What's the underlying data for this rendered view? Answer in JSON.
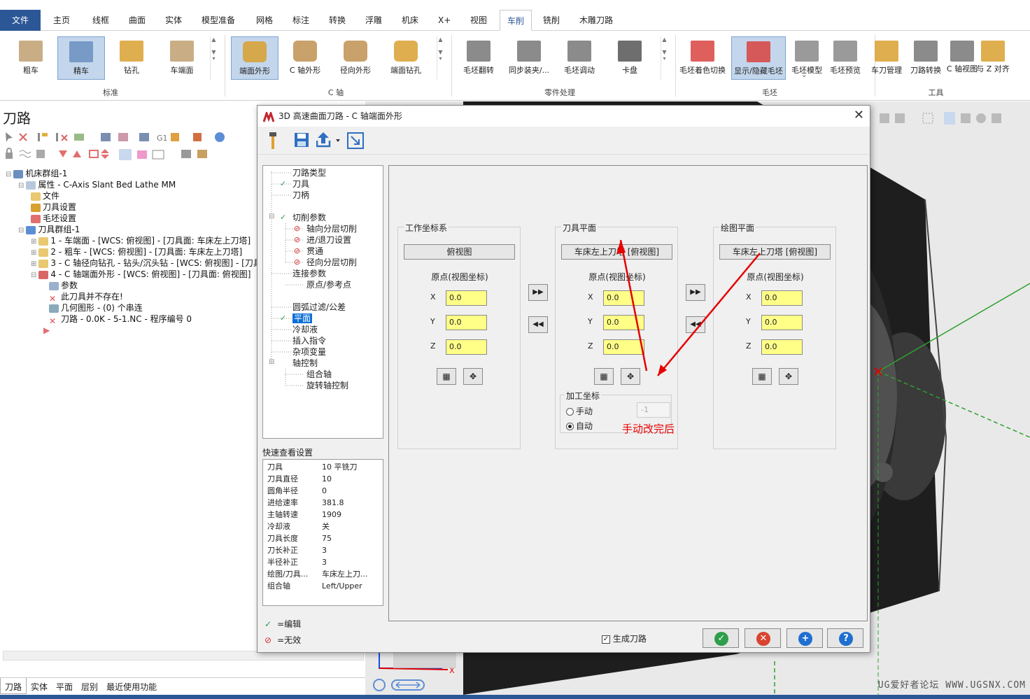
{
  "tabs": [
    "主页",
    "线框",
    "曲面",
    "实体",
    "模型准备",
    "网格",
    "标注",
    "转换",
    "浮雕",
    "机床",
    "X+",
    "视图",
    "车削",
    "铣削",
    "木雕刀路"
  ],
  "file_tab": "文件",
  "active_tab_index": 12,
  "ribbon": {
    "groups": [
      {
        "label": "标准",
        "buttons": [
          "粗车",
          "精车",
          "钻孔",
          "车端面"
        ]
      },
      {
        "label": "C 轴",
        "buttons": [
          "端面外形",
          "C 轴外形",
          "径向外形",
          "端面钻孔"
        ]
      },
      {
        "label": "零件处理",
        "buttons": [
          "毛坯翻转",
          "同步装夹/...",
          "毛坯调动",
          "卡盘"
        ]
      },
      {
        "label": "毛坯",
        "buttons": [
          "毛坯着色切换",
          "显示/隐藏毛坯",
          "毛坯模型",
          "毛坯预览"
        ]
      },
      {
        "label": "工具",
        "buttons": [
          "车刀管理",
          "刀路转换",
          "C 轴视图",
          "与 Z 对齐"
        ]
      }
    ],
    "stock_model_arrow": "⌄"
  },
  "left_panel": {
    "title": "刀路",
    "tree": [
      {
        "indent": 0,
        "label": "机床群组-1",
        "icon": "machine-icon"
      },
      {
        "indent": 1,
        "label": "属性 - C-Axis Slant Bed Lathe MM",
        "icon": "properties-icon"
      },
      {
        "indent": 2,
        "label": "文件",
        "icon": "folder-icon"
      },
      {
        "indent": 2,
        "label": "刀具设置",
        "icon": "tool-settings-icon"
      },
      {
        "indent": 2,
        "label": "毛坯设置",
        "icon": "stock-icon"
      },
      {
        "indent": 1,
        "label": "刀具群组-1",
        "icon": "toolgroup-icon"
      },
      {
        "indent": 2,
        "label": "1 - 车端面 - [WCS: 俯视图] - [刀具面: 车床左上刀塔]",
        "icon": "folder-icon"
      },
      {
        "indent": 2,
        "label": "2 - 粗车 - [WCS: 俯视图] - [刀具面: 车床左上刀塔]",
        "icon": "folder-icon"
      },
      {
        "indent": 2,
        "label": "3 - C 轴径向钻孔 - 钻头/沉头钻 - [WCS: 俯视图] - [刀具",
        "icon": "folder-icon"
      },
      {
        "indent": 2,
        "label": "4 - C 轴端面外形 - [WCS: 俯视图] - [刀具面: 俯视图]",
        "icon": "op-invalid-icon"
      },
      {
        "indent": 3,
        "label": "参数",
        "icon": "params-icon"
      },
      {
        "indent": 3,
        "label": "此刀具并不存在!",
        "icon": "error-icon"
      },
      {
        "indent": 3,
        "label": "几何图形 - (0) 个串连",
        "icon": "geometry-icon"
      },
      {
        "indent": 3,
        "label": "刀路 - 0.0K - 5-1.NC - 程序编号 0",
        "icon": "error-icon"
      }
    ],
    "bottom_tabs": [
      "刀路",
      "实体",
      "平面",
      "层别",
      "最近使用功能"
    ]
  },
  "dialog": {
    "title": "3D 高速曲面刀路 - C 轴端面外形",
    "nav": [
      {
        "label": "刀路类型",
        "status": ""
      },
      {
        "label": "刀具",
        "status": "check"
      },
      {
        "label": "刀柄",
        "status": ""
      },
      {
        "label": "切削参数",
        "status": "check"
      },
      {
        "label": "轴向分层切削",
        "status": "invalid"
      },
      {
        "label": "进/退刀设置",
        "status": "invalid"
      },
      {
        "label": "贯通",
        "status": "invalid"
      },
      {
        "label": "径向分层切削",
        "status": "invalid"
      },
      {
        "label": "连接参数",
        "status": ""
      },
      {
        "label": "原点/参考点",
        "status": ""
      },
      {
        "label": "圆弧过滤/公差",
        "status": ""
      },
      {
        "label": "平面",
        "status": "check"
      },
      {
        "label": "冷却液",
        "status": ""
      },
      {
        "label": "插入指令",
        "status": ""
      },
      {
        "label": "杂项变量",
        "status": ""
      },
      {
        "label": "轴控制",
        "status": ""
      },
      {
        "label": "组合轴",
        "status": ""
      },
      {
        "label": "旋转轴控制",
        "status": ""
      }
    ],
    "quick_view_label": "快速查看设置",
    "quick_view": [
      {
        "k": "刀具",
        "v": "10 平铣刀"
      },
      {
        "k": "刀具直径",
        "v": "10"
      },
      {
        "k": "圆角半径",
        "v": "0"
      },
      {
        "k": "进给速率",
        "v": "381.8"
      },
      {
        "k": "主轴转速",
        "v": "1909"
      },
      {
        "k": "冷却液",
        "v": "关"
      },
      {
        "k": "刀具长度",
        "v": "75"
      },
      {
        "k": "刀长补正",
        "v": "3"
      },
      {
        "k": "半径补正",
        "v": "3"
      },
      {
        "k": "绘图/刀具...",
        "v": "车床左上刀..."
      },
      {
        "k": "组合轴",
        "v": "Left/Upper"
      }
    ],
    "legend_edit": "=编辑",
    "legend_invalid": "=无效",
    "groups": {
      "wcs": {
        "title": "工作坐标系",
        "view": "俯视图",
        "origin_label": "原点(视图坐标)",
        "x": "0.0",
        "y": "0.0",
        "z": "0.0"
      },
      "tool": {
        "title": "刀具平面",
        "view": "车床左上刀塔 [俯视图]",
        "origin_label": "原点(视图坐标)",
        "x": "0.0",
        "y": "0.0",
        "z": "0.0"
      },
      "cplane": {
        "title": "绘图平面",
        "view": "车床左上刀塔 [俯视图]",
        "origin_label": "原点(视图坐标)",
        "x": "0.0",
        "y": "0.0",
        "z": "0.0"
      }
    },
    "axis_labels": {
      "x": "X",
      "y": "Y",
      "z": "Z"
    },
    "machining_coord": {
      "title": "加工坐标",
      "manual": "手动",
      "auto": "自动",
      "value": "-1",
      "selected": "auto"
    },
    "generate_toolpath": "生成刀路",
    "generate_checked": true
  },
  "annotation": "手动改完后",
  "watermark": "UG爱好者论坛 WWW.UGSNX.COM",
  "colors": {
    "accent": "#2b5797",
    "input_bg": "#ffff88",
    "annotation": "#e60000",
    "ok": "#2e9e4a",
    "cancel": "#d9432f",
    "add": "#1f6fd1",
    "help": "#1f6fd1"
  }
}
